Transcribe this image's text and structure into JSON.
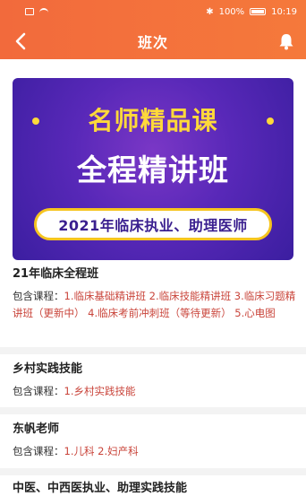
{
  "status_bar": {
    "battery": "100%",
    "time": "10:19"
  },
  "header": {
    "title": "班次"
  },
  "banner": {
    "heading": "名师精品课",
    "title": "全程精讲班",
    "pill": "2021年临床执业、助理医师"
  },
  "sections": [
    {
      "title": "21年临床全程班",
      "label": "包含课程：",
      "courses": "1.临床基础精讲班 2.临床技能精讲班 3.临床习题精讲班（更新中） 4.临床考前冲刺班（等待更新） 5.心电图"
    },
    {
      "title": "乡村实践技能",
      "label": "包含课程：",
      "courses": "1.乡村实践技能"
    },
    {
      "title": "东帆老师",
      "label": "包含课程：",
      "courses": "1.儿科 2.妇产科"
    },
    {
      "title": "中医、中西医执业、助理实践技能"
    }
  ],
  "colors": {
    "header": "#f26a3c",
    "course_text": "#c9443a",
    "banner_bg": "#5828b8",
    "banner_heading": "#ffd93a"
  },
  "icons": {
    "back": "chevron-left-icon",
    "bell": "bell-icon"
  }
}
